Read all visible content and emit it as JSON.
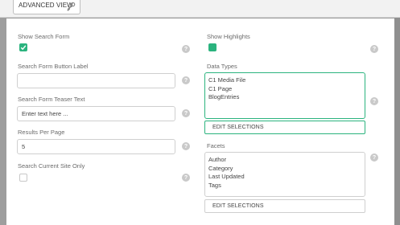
{
  "toolbar": {
    "advanced_view_label": "ADVANCED VIEW"
  },
  "left_column": {
    "show_search_form": {
      "label": "Show Search Form",
      "checked": true
    },
    "search_form_button_label": {
      "label": "Search Form Button Label",
      "value": ""
    },
    "search_form_teaser_text": {
      "label": "Search Form Teaser Text",
      "value": "Enter text here ..."
    },
    "results_per_page": {
      "label": "Results Per Page",
      "value": "5"
    },
    "search_current_site_only": {
      "label": "Search Current Site Only",
      "checked": false
    }
  },
  "right_column": {
    "show_highlights": {
      "label": "Show Highlights",
      "checked": true
    },
    "data_types": {
      "label": "Data Types",
      "items": [
        "C1 Media File",
        "C1 Page",
        "BlogEntries"
      ],
      "edit_label": "EDIT SELECTIONS"
    },
    "facets": {
      "label": "Facets",
      "items": [
        "Author",
        "Category",
        "Last Updated",
        "Tags"
      ],
      "edit_label": "EDIT SELECTIONS"
    }
  },
  "help_glyph": "?",
  "colors": {
    "accent": "#2bb37e",
    "help": "#c9c9c9",
    "backdrop": "#9a9a9a"
  },
  "icons": {
    "advanced_view": "settings-wrench-icon",
    "help": "help-icon",
    "check": "checkmark-icon"
  }
}
